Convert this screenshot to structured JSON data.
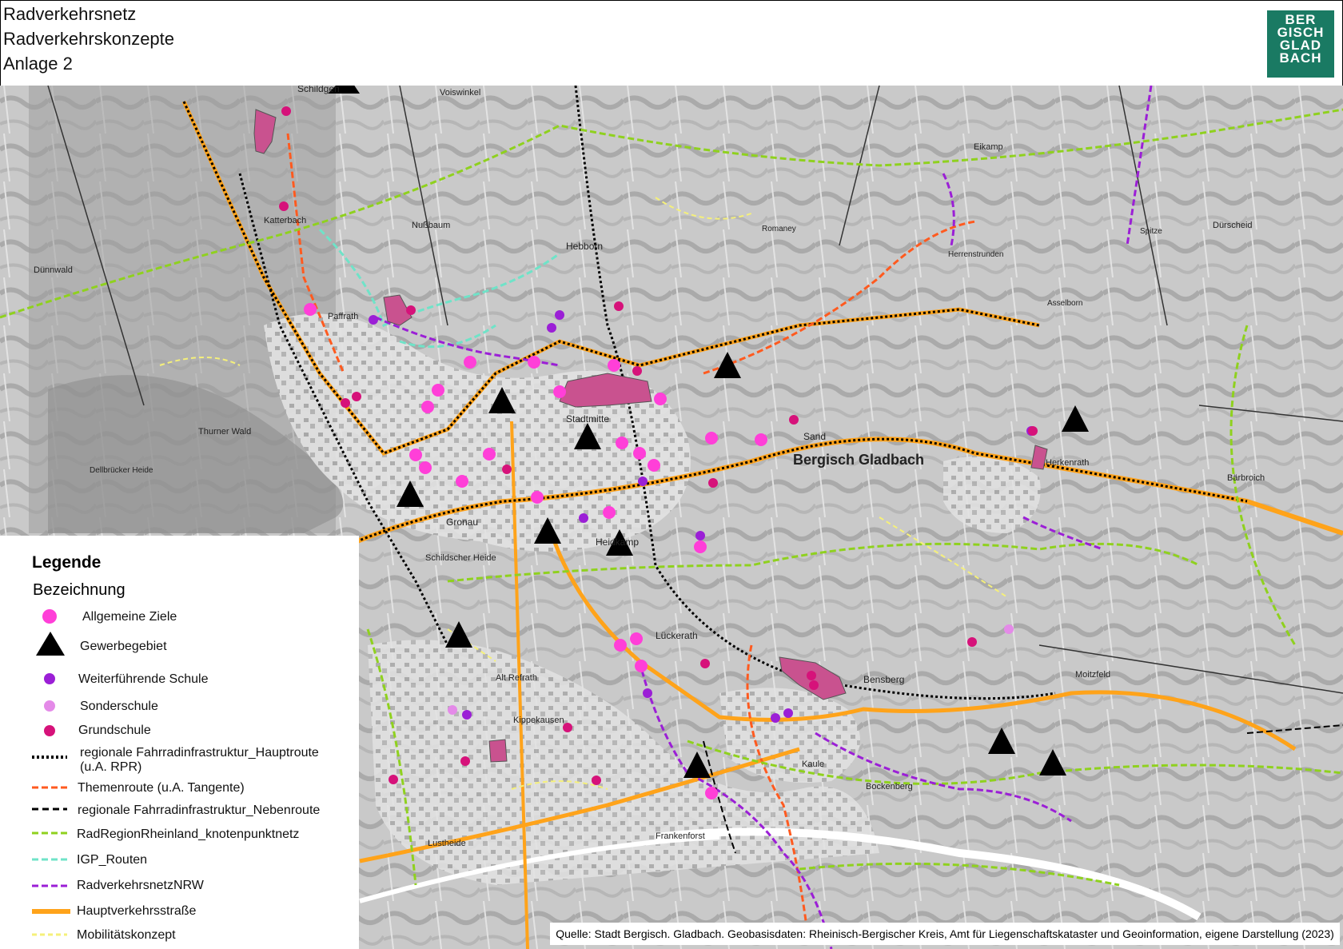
{
  "header": {
    "title1": "Radverkehrsnetz",
    "title2": "Radverkehrskonzepte",
    "title3": "Anlage 2",
    "logo": {
      "lines": [
        "BER",
        "GISCH",
        "GLAD",
        "BACH"
      ],
      "color": "#1a7a63"
    }
  },
  "legend": {
    "title": "Legende",
    "subtitle": "Bezeichnung",
    "items": [
      {
        "label": "Allgemeine Ziele",
        "symbol": "circle-large",
        "color": "#ff3fd8"
      },
      {
        "label": "Gewerbegebiet",
        "symbol": "triangle",
        "color": "#000000"
      },
      {
        "label": "Weiterführende Schule",
        "symbol": "circle-small",
        "color": "#9b1fd6"
      },
      {
        "label": "Sonderschule",
        "symbol": "circle-small",
        "color": "#e48ae8"
      },
      {
        "label": "Grundschule",
        "symbol": "circle-small",
        "color": "#d6127a"
      },
      {
        "label": "regionale Fahrradinfrastruktur_Hauptroute",
        "label2": "(u.A. RPR)",
        "symbol": "dotted",
        "color": "#000000"
      },
      {
        "label": "Themenroute (u.A. Tangente)",
        "symbol": "dashed",
        "color": "#ff5a1f"
      },
      {
        "label": "regionale Fahrradinfrastruktur_Nebenroute",
        "symbol": "dashed",
        "color": "#000000"
      },
      {
        "label": "RadRegionRheinland_knotenpunktnetz",
        "symbol": "dashed",
        "color": "#8fd11e"
      },
      {
        "label": "IGP_Routen",
        "symbol": "dashed",
        "color": "#6fe3c8"
      },
      {
        "label": "RadverkehrsnetzNRW",
        "symbol": "dashed",
        "color": "#9b1fd6"
      },
      {
        "label": "Hauptverkehrsstraße",
        "symbol": "thick",
        "color": "#ffa31a"
      },
      {
        "label": "Mobilitätskonzept",
        "symbol": "dashed",
        "color": "#f5f07a"
      }
    ]
  },
  "map": {
    "places": [
      "Schildgen",
      "Voiswinkel",
      "Katterbach",
      "Nußbaum",
      "Dünnwald",
      "Paffrath",
      "Hebborn",
      "Romaney",
      "Eikamp",
      "Herrenstrunden",
      "Spitze",
      "Dürscheid",
      "Asselborn",
      "Stadtmitte",
      "Sand",
      "Bergisch Gladbach",
      "Herkenrath",
      "Bärbroich",
      "Thurner Wald",
      "Dellbrücker Heide",
      "Gronau",
      "Heidkamp",
      "Schildscher Heide",
      "Lückerath",
      "Alt Refrath",
      "Kippekausen",
      "Bensberg",
      "Moitzfeld",
      "Kaule",
      "Bockenberg",
      "Frankenforst",
      "Lustheide"
    ]
  },
  "source": "Quelle: Stadt Bergisch. Gladbach.  Geobasisdaten: Rheinisch-Bergischer Kreis, Amt für Liegenschaftskataster und Geoinformation, eigene Darstellung (2023)"
}
